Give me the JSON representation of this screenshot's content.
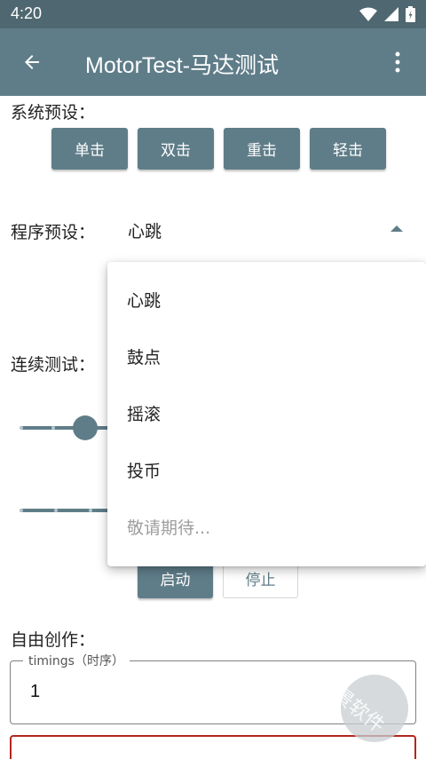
{
  "status_bar": {
    "time": "4:20"
  },
  "app_bar": {
    "title": "MotorTest-马达测试"
  },
  "system_presets": {
    "label": "系统预设：",
    "buttons": [
      "单击",
      "双击",
      "重击",
      "轻击"
    ]
  },
  "program_presets": {
    "label": "程序预设：",
    "selected": "心跳",
    "options": [
      "心跳",
      "鼓点",
      "摇滚",
      "投币",
      "敬请期待..."
    ]
  },
  "continuous_test": {
    "label": "连续测试：",
    "start_label": "启动",
    "stop_label": "停止"
  },
  "free_creation": {
    "label": "自由创作：",
    "timings_label": "timings（时序）",
    "timings_value": "1"
  },
  "colors": {
    "primary": "#5f7d89",
    "status_bar": "#4f6770",
    "error": "#b3261e"
  }
}
